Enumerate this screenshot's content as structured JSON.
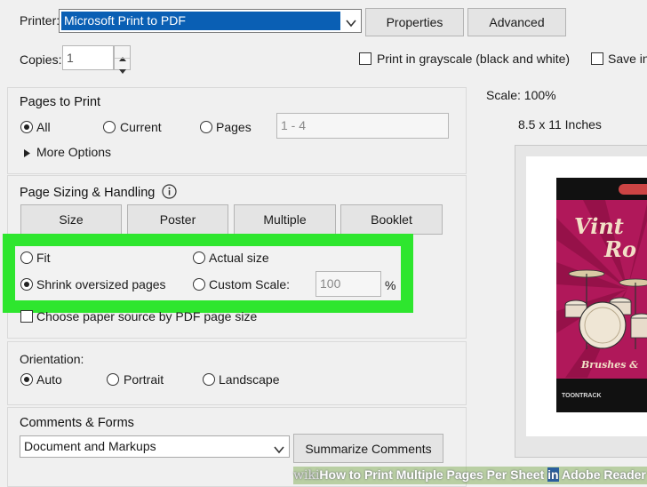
{
  "printer": {
    "label": "Printer:",
    "selected": "Microsoft Print to PDF",
    "properties_button": "Properties",
    "advanced_button": "Advanced"
  },
  "copies": {
    "label": "Copies:",
    "value": "1"
  },
  "grayscale": {
    "label": "Print in grayscale (black and white)",
    "checked": false
  },
  "save_ink": {
    "label": "Save ink",
    "checked": false
  },
  "pages_to_print": {
    "heading": "Pages to Print",
    "all": "All",
    "current": "Current",
    "pages": "Pages",
    "range_value": "1 - 4",
    "more_options": "More Options"
  },
  "page_sizing": {
    "heading": "Page Sizing & Handling",
    "tabs": [
      "Size",
      "Poster",
      "Multiple",
      "Booklet"
    ],
    "fit": "Fit",
    "actual_size": "Actual size",
    "shrink": "Shrink oversized pages",
    "custom_scale": "Custom Scale:",
    "custom_scale_value": "100",
    "percent": "%",
    "paper_source": "Choose paper source by PDF page size"
  },
  "orientation": {
    "heading": "Orientation:",
    "auto": "Auto",
    "portrait": "Portrait",
    "landscape": "Landscape"
  },
  "comments_forms": {
    "heading": "Comments & Forms",
    "selected": "Document and Markups",
    "summarize_button": "Summarize Comments"
  },
  "preview": {
    "scale": "Scale: 100%",
    "paper_size": "8.5 x 11 Inches",
    "cover_title_1": "Vint",
    "cover_title_2": "Ro",
    "cover_subtitle": "Brushes &",
    "cover_brand": "TOONTRACK"
  },
  "watermark": {
    "wiki": "wiki",
    "text_pre": "How to Print Multiple Pages Per Sheet ",
    "text_in": "in",
    "text_post": " Adobe Reader"
  },
  "colors": {
    "highlight": "#2ee62e",
    "selection": "#0a5fb4",
    "cover_magenta": "#b0185a"
  }
}
